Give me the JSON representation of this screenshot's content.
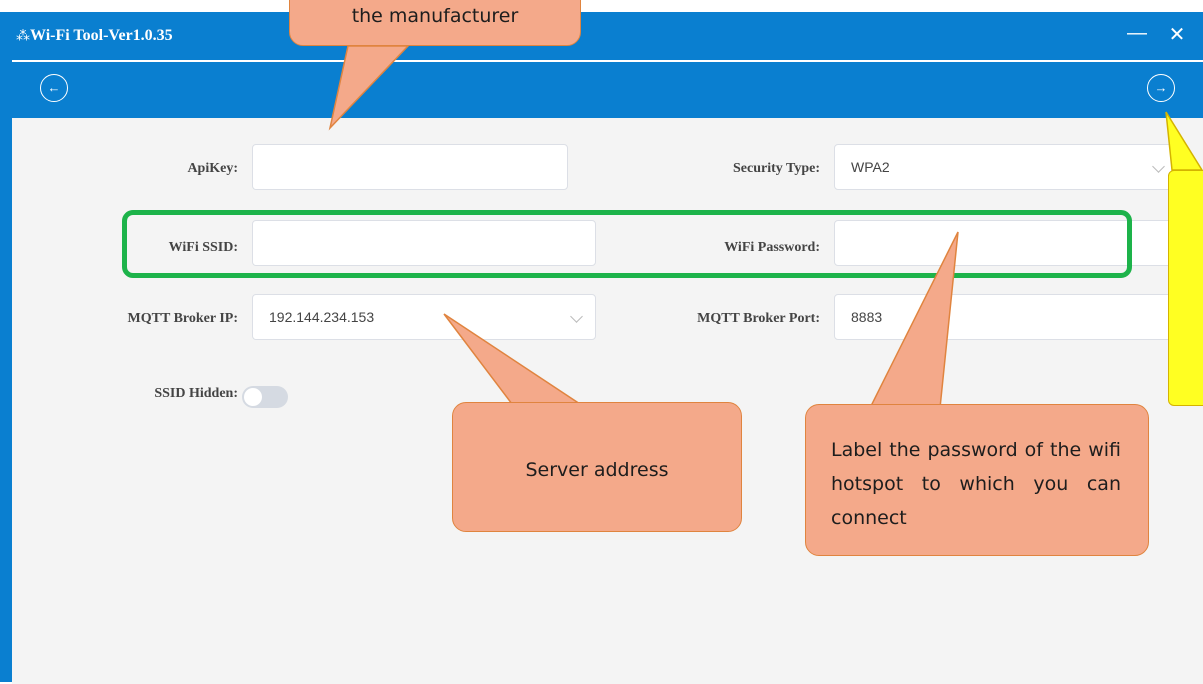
{
  "window": {
    "title": "Wi-Fi Tool-Ver1.0.35",
    "minimize_glyph": "—",
    "close_glyph": "✕",
    "logo_glyph": "⁂"
  },
  "nav": {
    "back_glyph": "←",
    "forward_glyph": "→"
  },
  "form": {
    "apikey": {
      "label": "ApiKey:",
      "value": ""
    },
    "security_type": {
      "label": "Security Type:",
      "value": "WPA2"
    },
    "wifi_ssid": {
      "label": "WiFi SSID:",
      "value": ""
    },
    "wifi_password": {
      "label": "WiFi Password:",
      "value": ""
    },
    "mqtt_ip": {
      "label": "MQTT Broker IP:",
      "value": "192.144.234.153"
    },
    "mqtt_port": {
      "label": "MQTT Broker Port:",
      "value": "8883"
    },
    "ssid_hidden": {
      "label": "SSID Hidden:",
      "on": false
    }
  },
  "annotations": {
    "top_callout": "the manufacturer",
    "server_callout": "Server address",
    "password_callout": "Label the password of the wifi hotspot to which you can connect"
  },
  "colors": {
    "accent": "#0a7fd0",
    "highlight": "#1db34a",
    "callout": "#f4a98a",
    "note": "#ffff22"
  }
}
